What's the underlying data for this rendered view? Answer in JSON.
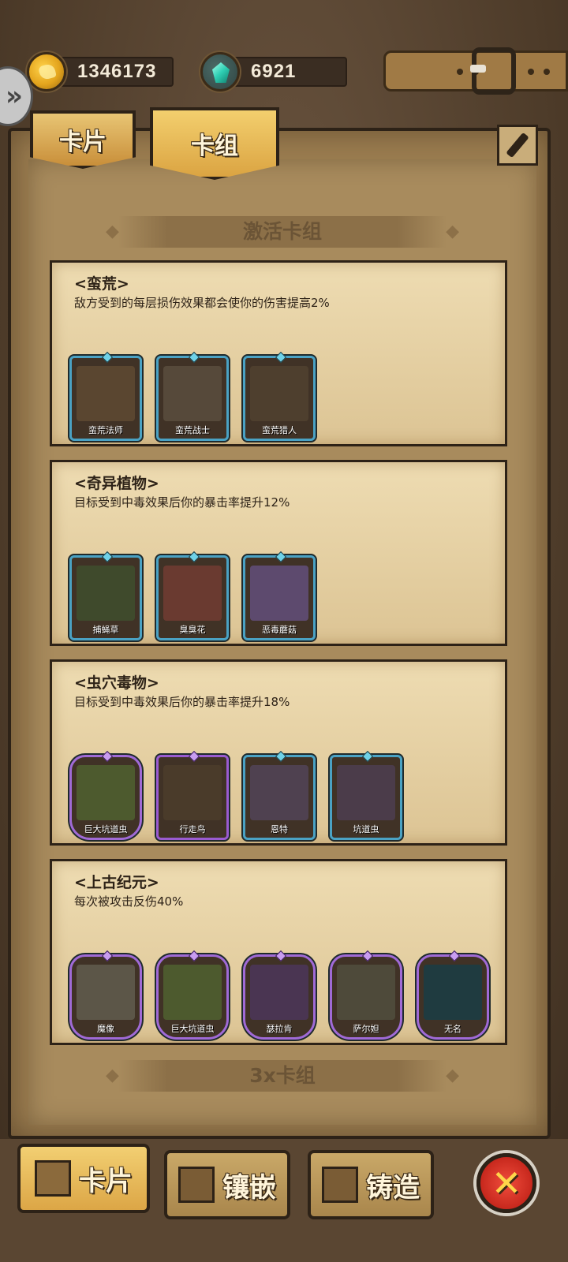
{
  "currency": {
    "gold": "1346173",
    "gems": "6921"
  },
  "tabs": {
    "cards": "卡片",
    "deck": "卡组"
  },
  "sections": {
    "active_decks": "激活卡组",
    "triple_decks": "3x卡组"
  },
  "decks": [
    {
      "name": "<蛮荒>",
      "desc": "敌方受到的每层损伤效果都会使你的伤害提高2%",
      "cards": [
        {
          "name": "蛮荒法师",
          "rarity": "rare",
          "art": "#5a4630"
        },
        {
          "name": "蛮荒战士",
          "rarity": "rare",
          "art": "#56493a"
        },
        {
          "name": "蛮荒猎人",
          "rarity": "rare",
          "art": "#4e3f2e"
        }
      ]
    },
    {
      "name": "<奇异植物>",
      "desc": "目标受到中毒效果后你的暴击率提升12%",
      "cards": [
        {
          "name": "捕蝇草",
          "rarity": "rare",
          "art": "#3f4a2c"
        },
        {
          "name": "臭臭花",
          "rarity": "rare",
          "art": "#6a3a30"
        },
        {
          "name": "恶毒蘑菇",
          "rarity": "rare",
          "art": "#5d4a6e"
        }
      ]
    },
    {
      "name": "<虫穴毒物>",
      "desc": "目标受到中毒效果后你的暴击率提升18%",
      "cards": [
        {
          "name": "巨大坑道虫",
          "rarity": "epic",
          "art": "#4d5a2e"
        },
        {
          "name": "行走鸟",
          "rarity": "purple",
          "art": "#4a3b2a"
        },
        {
          "name": "恩特",
          "rarity": "rare",
          "art": "#4f4150"
        },
        {
          "name": "坑道虫",
          "rarity": "rare",
          "art": "#4b3c4a"
        }
      ]
    },
    {
      "name": "<上古纪元>",
      "desc": "每次被攻击反伤40%",
      "cards": [
        {
          "name": "魔像",
          "rarity": "epic",
          "art": "#5c5648"
        },
        {
          "name": "巨大坑道虫",
          "rarity": "epic",
          "art": "#4d5a2e"
        },
        {
          "name": "瑟拉肯",
          "rarity": "epic",
          "art": "#4a3552"
        },
        {
          "name": "萨尔妲",
          "rarity": "epic",
          "art": "#4e4a3a"
        },
        {
          "name": "无名",
          "rarity": "epic",
          "art": "#1f3b40"
        }
      ]
    }
  ],
  "bottom_nav": {
    "cards": "卡片",
    "inlay": "镶嵌",
    "forge": "铸造",
    "close": "✕"
  }
}
